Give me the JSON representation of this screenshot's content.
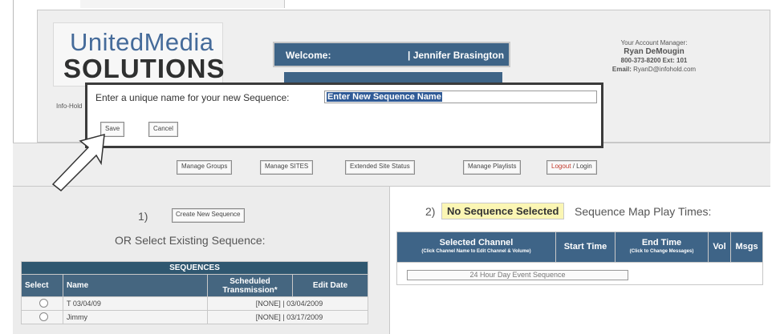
{
  "header": {
    "logo_line1": "UnitedMedia",
    "logo_line2": "SOLUTIONS",
    "logo_fragment": "Info-Hold",
    "welcome_label": "Welcome:",
    "user_name": "| Jennifer Brasington",
    "account": {
      "title": "Your Account Manager:",
      "name": "Ryan DeMougin",
      "phone": "800-373-8200 Ext: 101",
      "email_label": "Email:",
      "email": "RyanD@infohold.com"
    }
  },
  "modal": {
    "label": "Enter a unique name for your new Sequence:",
    "input_value": "Enter New Sequence Name",
    "save_label": "Save",
    "cancel_label": "Cancel"
  },
  "nav": {
    "manage_groups": "Manage Groups",
    "manage_sites": "Manage SITES",
    "extended_status": "Extended Site Status",
    "manage_playlists": "Manage Playlists",
    "logout": "Logout",
    "login": " / Login"
  },
  "left": {
    "step": "1)",
    "create_label": "Create New Sequence",
    "or_select": "OR Select Existing Sequence:",
    "table": {
      "title": "SEQUENCES",
      "col_select": "Select",
      "col_name": "Name",
      "col_sched": "Scheduled Transmission*",
      "col_edit": "Edit Date",
      "rows": [
        {
          "name": "T 03/04/09",
          "sched": "[NONE]",
          "edit": "| 03/04/2009"
        },
        {
          "name": "Jimmy",
          "sched": "[NONE]",
          "edit": "| 03/17/2009"
        }
      ]
    }
  },
  "right": {
    "step": "2)",
    "no_sequence": "No Sequence Selected",
    "map_title": "Sequence Map Play Times:",
    "cols": {
      "channel": "Selected Channel",
      "channel_hint": "(Click Channel Name to Edit Channel & Volume)",
      "start": "Start Time",
      "end": "End Time",
      "end_hint": "(Click to Change Messages)",
      "vol": "Vol",
      "msgs": "Msgs"
    },
    "event_label": "24 Hour Day Event Sequence"
  }
}
